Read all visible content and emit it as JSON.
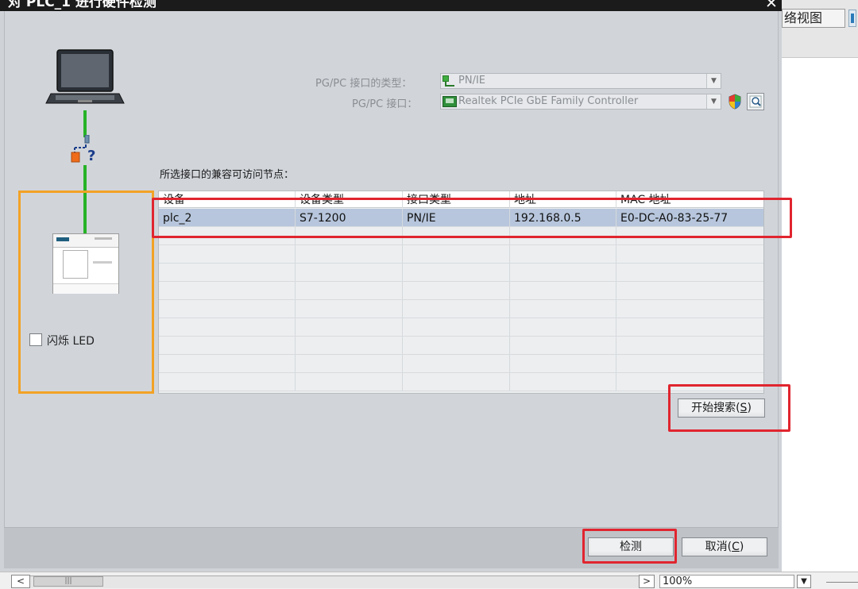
{
  "dialog": {
    "title": "对 PLC_1 进行硬件检测",
    "close_label": "✕"
  },
  "interface": {
    "type_label": "PG/PC 接口的类型：",
    "type_value": "PN/IE",
    "iface_label": "PG/PC 接口：",
    "iface_value": "Realtek PCIe GbE Family Controller",
    "icons": {
      "type": "network-icon",
      "iface": "nic-icon",
      "shield": "shield-icon",
      "search": "search-icon"
    }
  },
  "graphic": {
    "unknown_marker": "?",
    "led_checkbox_label": "闪烁 LED",
    "led_checked": false
  },
  "nodes": {
    "title": "所选接口的兼容可访问节点：",
    "columns": [
      "设备",
      "设备类型",
      "接口类型",
      "地址",
      "MAC 地址"
    ],
    "rows": [
      [
        "plc_2",
        "S7-1200",
        "PN/IE",
        "192.168.0.5",
        "E0-DC-A0-83-25-77"
      ]
    ],
    "selected_row": 0
  },
  "buttons": {
    "start_search_text": "开始搜索(",
    "start_search_key": "S",
    "start_search_end": ")",
    "detect": "检测",
    "cancel_text": "取消(",
    "cancel_key": "C",
    "cancel_end": ")"
  },
  "background": {
    "tab_label": "络视图",
    "zoom_value": "100%",
    "scroll_left": "<",
    "scroll_right": ">",
    "zoom_dropdown": "▼"
  },
  "colors": {
    "highlight_red": "#e0252f",
    "orange_frame": "#f2a226",
    "link_green": "#27b327",
    "selected_row": "#b7c6dc"
  }
}
